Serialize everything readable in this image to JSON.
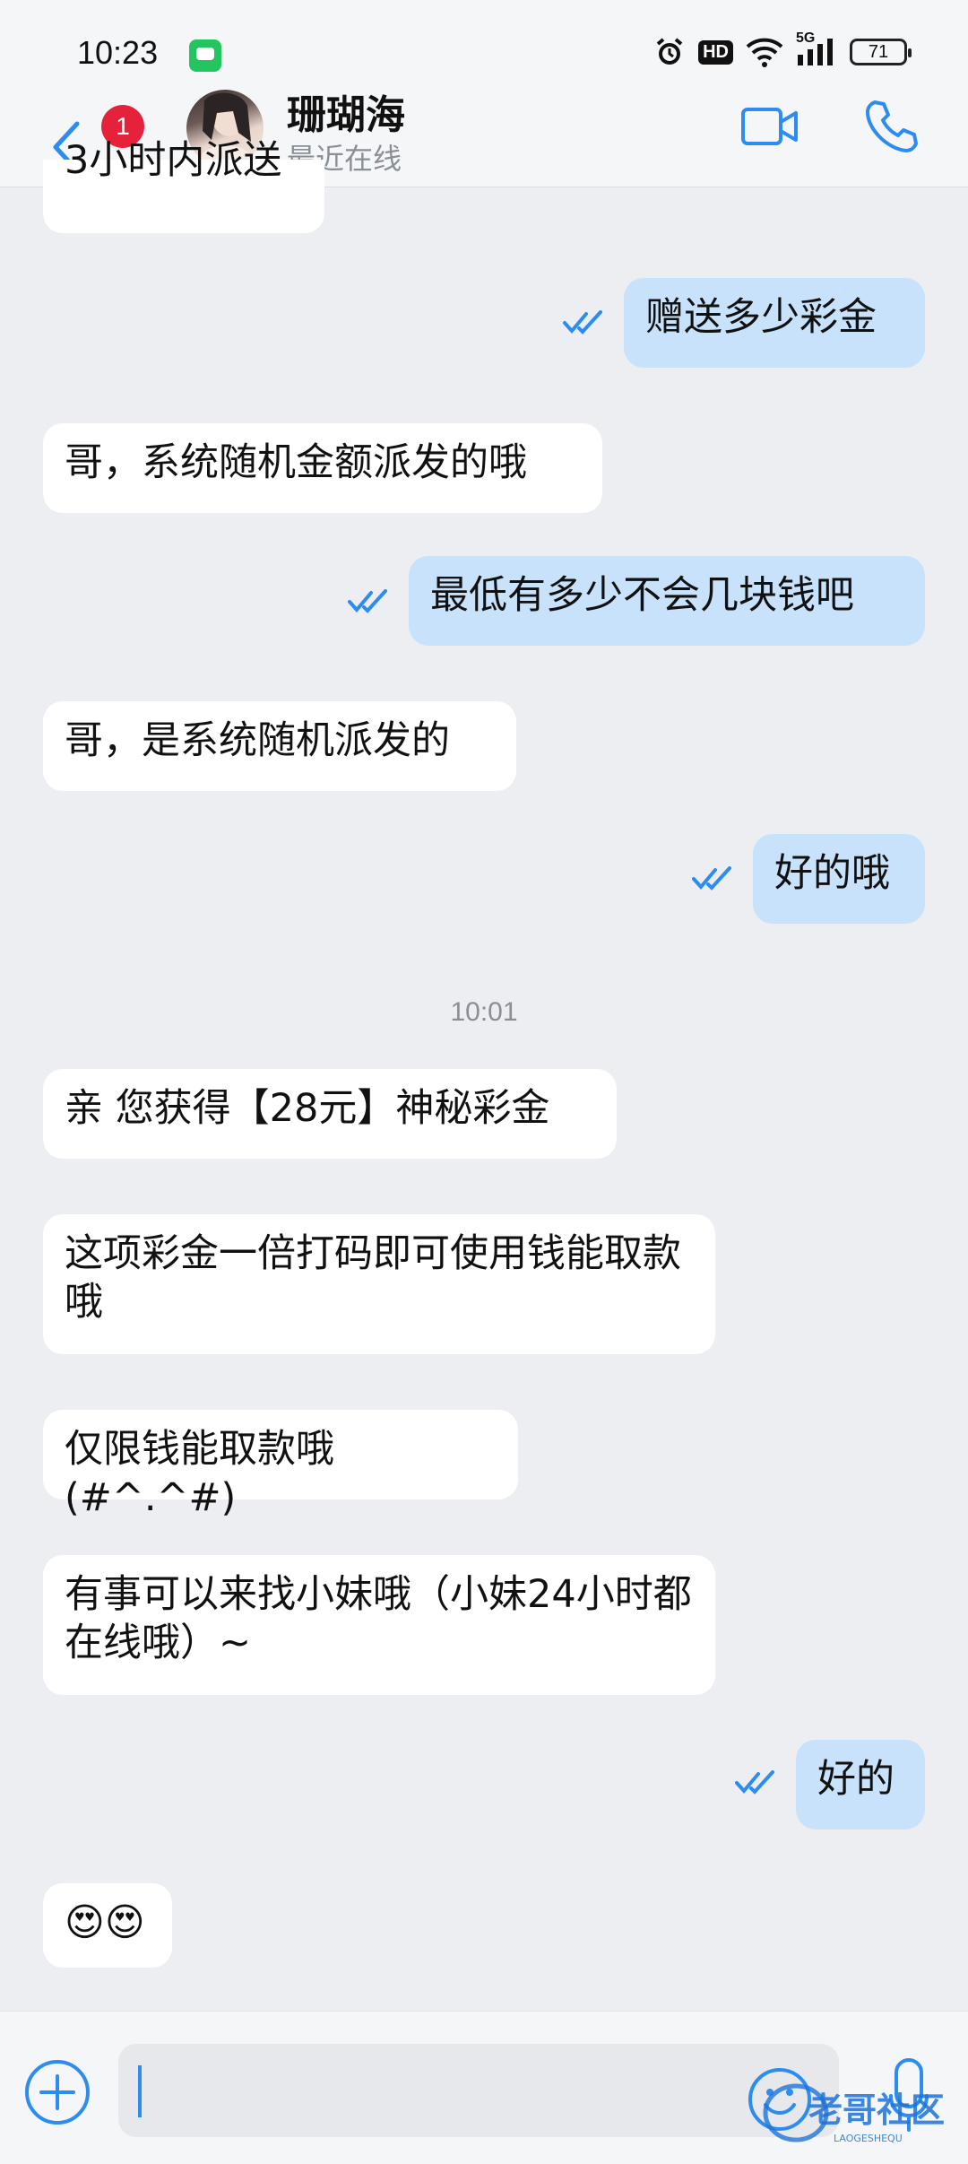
{
  "status_bar": {
    "time": "10:23",
    "network": "5G",
    "hd_label": "HD",
    "battery": "71"
  },
  "header": {
    "unread_count": "1",
    "contact_name": "珊瑚海",
    "contact_status": "最近在线"
  },
  "messages": [
    {
      "direction": "in",
      "text": "3小时内派送"
    },
    {
      "direction": "out",
      "text": "赠送多少彩金",
      "read": true
    },
    {
      "direction": "in",
      "text": "哥，系统随机金额派发的哦"
    },
    {
      "direction": "out",
      "text": "最低有多少不会几块钱吧",
      "read": true
    },
    {
      "direction": "in",
      "text": "哥，是系统随机派发的"
    },
    {
      "direction": "out",
      "text": "好的哦",
      "read": true
    },
    {
      "direction": "time",
      "text": "10:01"
    },
    {
      "direction": "in",
      "text": "亲 您获得【28元】神秘彩金"
    },
    {
      "direction": "in",
      "text": "这项彩金一倍打码即可使用钱能取款哦"
    },
    {
      "direction": "in",
      "text": "仅限钱能取款哦(#^.^#)"
    },
    {
      "direction": "in",
      "text": "有事可以来找小妹哦（小妹24小时都在线哦）~"
    },
    {
      "direction": "out",
      "text": "好的",
      "read": true
    },
    {
      "direction": "in",
      "text": "😍😍"
    }
  ],
  "input": {
    "value": "",
    "watermark_text": "老哥社区",
    "watermark_sub": "LAOGESHEQU"
  },
  "colors": {
    "accent": "#2d8cf0",
    "outgoing_bubble": "#c8e2fb",
    "incoming_bubble": "#ffffff",
    "badge": "#e5223a"
  }
}
